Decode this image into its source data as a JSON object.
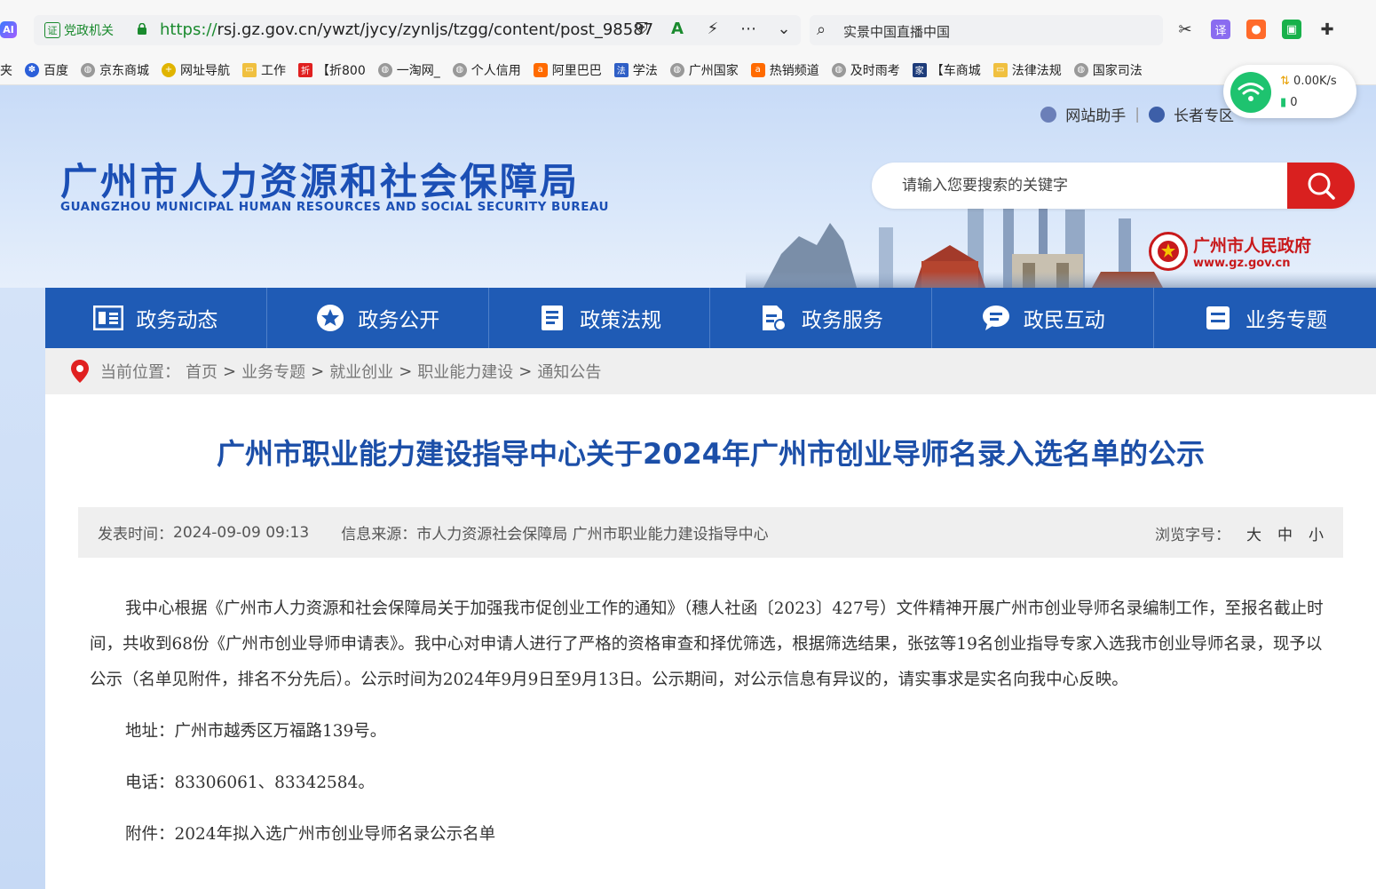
{
  "browser": {
    "ai_badge": "AI",
    "cert_label": "党政机关",
    "cert_mark": "证",
    "url_scheme": "https://",
    "url_rest": "rsj.gz.gov.cn/ywzt/jycy/zynljs/tzgg/content/post_98587",
    "search_query": "实景中国直播中国",
    "translate_label": "译",
    "bookmarks": [
      {
        "label": "夹"
      },
      {
        "label": "百度"
      },
      {
        "label": "京东商城"
      },
      {
        "label": "网址导航"
      },
      {
        "label": "工作"
      },
      {
        "label": "【折800"
      },
      {
        "label": "一淘网_"
      },
      {
        "label": "个人信用"
      },
      {
        "label": "阿里巴巴"
      },
      {
        "label": "学法"
      },
      {
        "label": "广州国家"
      },
      {
        "label": "热销频道"
      },
      {
        "label": "及时雨考"
      },
      {
        "label": "【车商城"
      },
      {
        "label": "法律法规"
      },
      {
        "label": "国家司法"
      }
    ],
    "net_widget": {
      "speed": "0.00K/s",
      "count": "0"
    }
  },
  "site": {
    "util_links": [
      "网站助手",
      "长者专区"
    ],
    "title": "广州市人力资源和社会保障局",
    "subtitle": "GUANGZHOU MUNICIPAL HUMAN RESOURCES AND SOCIAL SECURITY BUREAU",
    "search_placeholder": "请输入您要搜索的关键字",
    "gov_name": "广州市人民政府",
    "gov_url": "www.gz.gov.cn"
  },
  "nav": [
    {
      "label": "政务动态",
      "icon": "news-icon"
    },
    {
      "label": "政务公开",
      "icon": "star-icon"
    },
    {
      "label": "政策法规",
      "icon": "document-icon"
    },
    {
      "label": "政务服务",
      "icon": "service-icon"
    },
    {
      "label": "政民互动",
      "icon": "chat-icon"
    },
    {
      "label": "业务专题",
      "icon": "list-icon"
    }
  ],
  "breadcrumb": {
    "prefix": "当前位置：",
    "items": [
      "首页",
      "业务专题",
      "就业创业",
      "职业能力建设",
      "通知公告"
    ],
    "sep": ">"
  },
  "article": {
    "title": "广州市职业能力建设指导中心关于2024年广州市创业导师名录入选名单的公示",
    "publish_label": "发表时间：",
    "publish_time": "2024-09-09 09:13",
    "source_label": "信息来源：",
    "source": "市人力资源社会保障局 广州市职业能力建设指导中心",
    "fontsize_label": "浏览字号：",
    "fontsize_options": [
      "大",
      "中",
      "小"
    ],
    "paragraph": "我中心根据《广州市人力资源和社会保障局关于加强我市促创业工作的通知》（穗人社函〔2023〕427号）文件精神开展广州市创业导师名录编制工作，至报名截止时间，共收到68份《广州市创业导师申请表》。我中心对申请人进行了严格的资格审查和择优筛选，根据筛选结果，张弦等19名创业指导专家入选我市创业导师名录，现予以公示（名单见附件，排名不分先后）。公示时间为2024年9月9日至9月13日。公示期间，对公示信息有异议的，请实事求是实名向我中心反映。",
    "address": "地址：广州市越秀区万福路139号。",
    "phone": "电话：83306061、83342584。",
    "attachment": "附件：2024年拟入选广州市创业导师名录公示名单"
  }
}
